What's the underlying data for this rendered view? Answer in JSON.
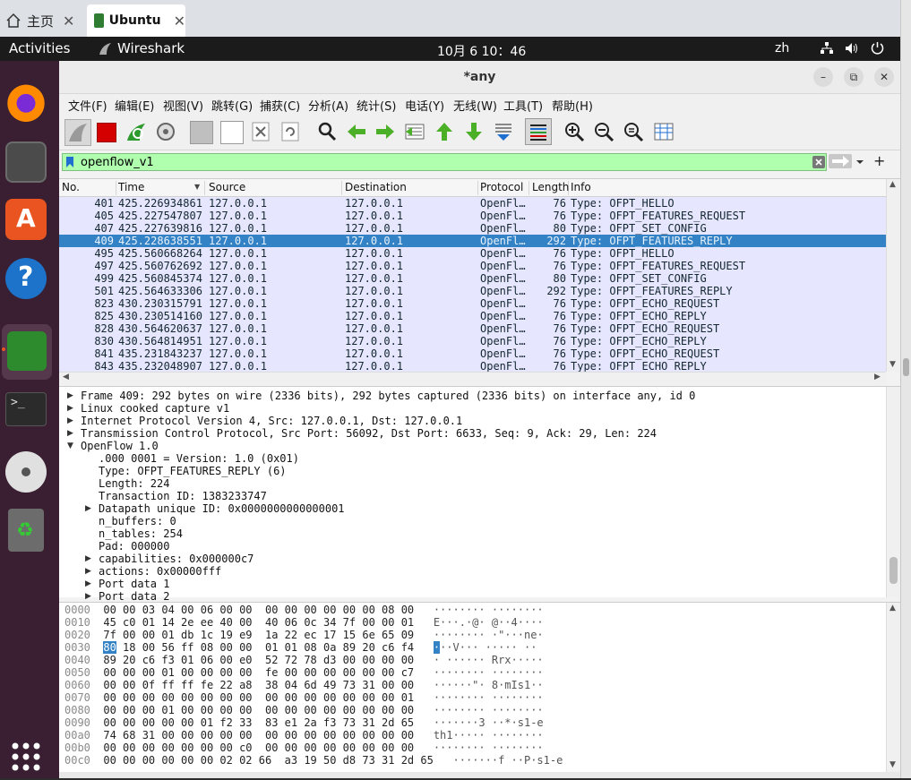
{
  "browser": {
    "tabs": [
      {
        "label": "主页",
        "icon": "home-icon"
      },
      {
        "label": "Ubuntu",
        "icon": "vm-icon"
      }
    ]
  },
  "topbar": {
    "activities": "Activities",
    "app_name": "Wireshark",
    "clock": "10月 6 10：46",
    "lang": "zh"
  },
  "dock": {
    "items": [
      "firefox-icon",
      "files-icon",
      "software-icon",
      "help-icon",
      "wireshark-icon",
      "terminal-icon",
      "dvd-icon",
      "trash-icon",
      "app-grid-icon"
    ]
  },
  "window": {
    "title": "*any",
    "buttons": {
      "minimize": "–",
      "restore": "⧉",
      "close": "✕"
    }
  },
  "menu": [
    "文件(F)",
    "编辑(E)",
    "视图(V)",
    "跳转(G)",
    "捕获(C)",
    "分析(A)",
    "统计(S)",
    "电话(Y)",
    "无线(W)",
    "工具(T)",
    "帮助(H)"
  ],
  "filter": {
    "value": "openflow_v1",
    "plus": "+"
  },
  "packet_list": {
    "columns": [
      "No.",
      "Time",
      "Source",
      "Destination",
      "Protocol",
      "Length",
      "Info"
    ],
    "rows": [
      {
        "no": "401",
        "time": "425.226934861",
        "src": "127.0.0.1",
        "dst": "127.0.0.1",
        "proto": "OpenFl…",
        "len": "76",
        "info": "Type: OFPT_HELLO"
      },
      {
        "no": "405",
        "time": "425.227547807",
        "src": "127.0.0.1",
        "dst": "127.0.0.1",
        "proto": "OpenFl…",
        "len": "76",
        "info": "Type: OFPT_FEATURES_REQUEST"
      },
      {
        "no": "407",
        "time": "425.227639816",
        "src": "127.0.0.1",
        "dst": "127.0.0.1",
        "proto": "OpenFl…",
        "len": "80",
        "info": "Type: OFPT_SET_CONFIG"
      },
      {
        "no": "409",
        "time": "425.228638551",
        "src": "127.0.0.1",
        "dst": "127.0.0.1",
        "proto": "OpenFl…",
        "len": "292",
        "info": "Type: OFPT_FEATURES_REPLY"
      },
      {
        "no": "495",
        "time": "425.560668264",
        "src": "127.0.0.1",
        "dst": "127.0.0.1",
        "proto": "OpenFl…",
        "len": "76",
        "info": "Type: OFPT_HELLO"
      },
      {
        "no": "497",
        "time": "425.560762692",
        "src": "127.0.0.1",
        "dst": "127.0.0.1",
        "proto": "OpenFl…",
        "len": "76",
        "info": "Type: OFPT_FEATURES_REQUEST"
      },
      {
        "no": "499",
        "time": "425.560845374",
        "src": "127.0.0.1",
        "dst": "127.0.0.1",
        "proto": "OpenFl…",
        "len": "80",
        "info": "Type: OFPT_SET_CONFIG"
      },
      {
        "no": "501",
        "time": "425.564633306",
        "src": "127.0.0.1",
        "dst": "127.0.0.1",
        "proto": "OpenFl…",
        "len": "292",
        "info": "Type: OFPT_FEATURES_REPLY"
      },
      {
        "no": "823",
        "time": "430.230315791",
        "src": "127.0.0.1",
        "dst": "127.0.0.1",
        "proto": "OpenFl…",
        "len": "76",
        "info": "Type: OFPT_ECHO_REQUEST"
      },
      {
        "no": "825",
        "time": "430.230514160",
        "src": "127.0.0.1",
        "dst": "127.0.0.1",
        "proto": "OpenFl…",
        "len": "76",
        "info": "Type: OFPT_ECHO_REPLY"
      },
      {
        "no": "828",
        "time": "430.564620637",
        "src": "127.0.0.1",
        "dst": "127.0.0.1",
        "proto": "OpenFl…",
        "len": "76",
        "info": "Type: OFPT_ECHO_REQUEST"
      },
      {
        "no": "830",
        "time": "430.564814951",
        "src": "127.0.0.1",
        "dst": "127.0.0.1",
        "proto": "OpenFl…",
        "len": "76",
        "info": "Type: OFPT_ECHO_REPLY"
      },
      {
        "no": "841",
        "time": "435.231843237",
        "src": "127.0.0.1",
        "dst": "127.0.0.1",
        "proto": "OpenFl…",
        "len": "76",
        "info": "Type: OFPT_ECHO_REQUEST"
      },
      {
        "no": "843",
        "time": "435.232048907",
        "src": "127.0.0.1",
        "dst": "127.0.0.1",
        "proto": "OpenFl…",
        "len": "76",
        "info": "Type: OFPT_ECHO_REPLY"
      }
    ]
  },
  "details": [
    {
      "text": "Frame 409: 292 bytes on wire (2336 bits), 292 bytes captured (2336 bits) on interface any, id 0",
      "level": 0,
      "caret": "right"
    },
    {
      "text": "Linux cooked capture v1",
      "level": 0,
      "caret": "right"
    },
    {
      "text": "Internet Protocol Version 4, Src: 127.0.0.1, Dst: 127.0.0.1",
      "level": 0,
      "caret": "right"
    },
    {
      "text": "Transmission Control Protocol, Src Port: 56092, Dst Port: 6633, Seq: 9, Ack: 29, Len: 224",
      "level": 0,
      "caret": "right"
    },
    {
      "text": "OpenFlow 1.0",
      "level": 0,
      "caret": "down"
    },
    {
      "text": ".000 0001 = Version: 1.0 (0x01)",
      "level": 1,
      "caret": ""
    },
    {
      "text": "Type: OFPT_FEATURES_REPLY (6)",
      "level": 1,
      "caret": ""
    },
    {
      "text": "Length: 224",
      "level": 1,
      "caret": ""
    },
    {
      "text": "Transaction ID: 1383233747",
      "level": 1,
      "caret": ""
    },
    {
      "text": "Datapath unique ID: 0x0000000000000001",
      "level": 1,
      "caret": "right"
    },
    {
      "text": "n_buffers: 0",
      "level": 1,
      "caret": ""
    },
    {
      "text": "n_tables: 254",
      "level": 1,
      "caret": ""
    },
    {
      "text": "Pad: 000000",
      "level": 1,
      "caret": ""
    },
    {
      "text": "capabilities: 0x000000c7",
      "level": 1,
      "caret": "right"
    },
    {
      "text": "actions: 0x00000fff",
      "level": 1,
      "caret": "right"
    },
    {
      "text": "Port data 1",
      "level": 1,
      "caret": "right"
    },
    {
      "text": "Port data 2",
      "level": 1,
      "caret": "right"
    }
  ],
  "bytes": [
    {
      "off": "0000",
      "hex": "00 00 03 04 00 06 00 00  00 00 00 00 00 00 08 00",
      "ascii": "········ ········"
    },
    {
      "off": "0010",
      "hex": "45 c0 01 14 2e ee 40 00  40 06 0c 34 7f 00 00 01",
      "ascii": "E···.·@· @··4····"
    },
    {
      "off": "0020",
      "hex": "7f 00 00 01 db 1c 19 e9  1a 22 ec 17 15 6e 65 09",
      "ascii": "········ ·\"···ne·"
    },
    {
      "off": "0030",
      "hl": "80",
      "hex": " 18 00 56 ff 08 00 00  01 01 08 0a 89 20 c6 f4",
      "hla": "·",
      "ascii": "··V··· ····· ··"
    },
    {
      "off": "0040",
      "hex": "89 20 c6 f3 01 06 00 e0  52 72 78 d3 00 00 00 00",
      "ascii": "· ······ Rrx·····"
    },
    {
      "off": "0050",
      "hex": "00 00 00 01 00 00 00 00  fe 00 00 00 00 00 00 c7",
      "ascii": "········ ········"
    },
    {
      "off": "0060",
      "hex": "00 00 0f ff ff fe 22 a8  38 04 6d 49 73 31 00 00",
      "ascii": "······\"· 8·mIs1··"
    },
    {
      "off": "0070",
      "hex": "00 00 00 00 00 00 00 00  00 00 00 00 00 00 00 01",
      "ascii": "········ ········"
    },
    {
      "off": "0080",
      "hex": "00 00 00 01 00 00 00 00  00 00 00 00 00 00 00 00",
      "ascii": "········ ········"
    },
    {
      "off": "0090",
      "hex": "00 00 00 00 00 01 f2 33  83 e1 2a f3 73 31 2d 65",
      "ascii": "·······3 ··*·s1-e"
    },
    {
      "off": "00a0",
      "hex": "74 68 31 00 00 00 00 00  00 00 00 00 00 00 00 00",
      "ascii": "th1····· ········"
    },
    {
      "off": "00b0",
      "hex": "00 00 00 00 00 00 00 c0  00 00 00 00 00 00 00 00",
      "ascii": "········ ········"
    },
    {
      "off": "00c0",
      "hex": "00 00 00 00 00 00 02 02 66  a3 19 50 d8 73 31 2d 65",
      "ascii": "·······f ··P·s1-e"
    }
  ]
}
